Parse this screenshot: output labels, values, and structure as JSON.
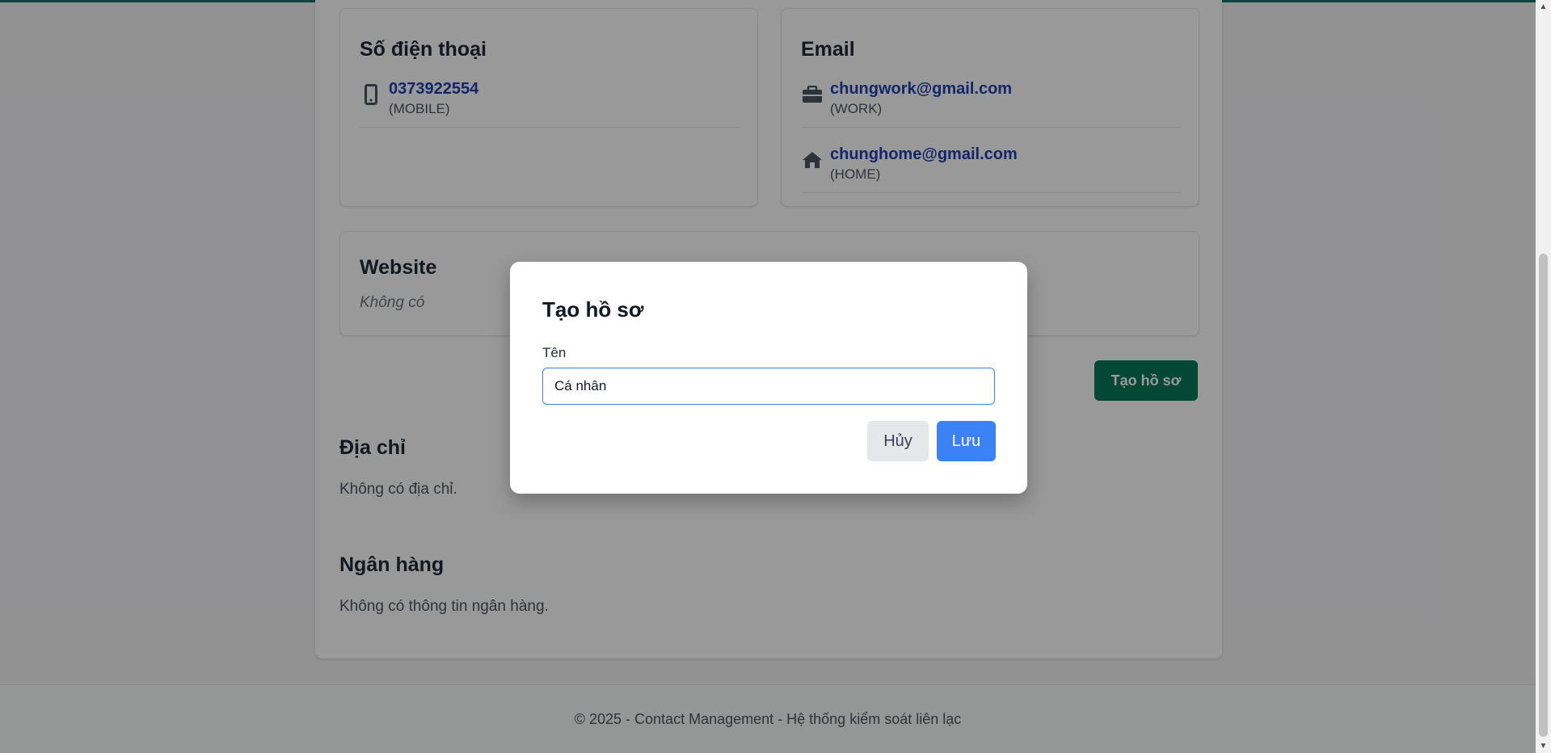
{
  "phone_card": {
    "title": "Số điện thoại",
    "items": [
      {
        "value": "0373922554",
        "type": "(MOBILE)",
        "icon": "mobile-phone-icon"
      }
    ]
  },
  "email_card": {
    "title": "Email",
    "items": [
      {
        "value": "chungwork@gmail.com",
        "type": "(WORK)",
        "icon": "briefcase-icon"
      },
      {
        "value": "chunghome@gmail.com",
        "type": "(HOME)",
        "icon": "home-icon"
      }
    ]
  },
  "website_card": {
    "title": "Website",
    "empty_text": "Không có"
  },
  "create_profile_button": "Tạo hồ sơ",
  "address_section": {
    "title": "Địa chỉ",
    "empty_text": "Không có địa chỉ."
  },
  "bank_section": {
    "title": "Ngân hàng",
    "empty_text": "Không có thông tin ngân hàng."
  },
  "footer": {
    "text": "© 2025 - Contact Management - Hệ thống kiểm soát liên lạc"
  },
  "modal": {
    "title": "Tạo hồ sơ",
    "name_label": "Tên",
    "name_value": "Cá nhân",
    "cancel_label": "Hủy",
    "save_label": "Lưu"
  },
  "colors": {
    "primary_green": "#047857",
    "primary_blue": "#3b82f6",
    "link_blue": "#1e40af"
  }
}
